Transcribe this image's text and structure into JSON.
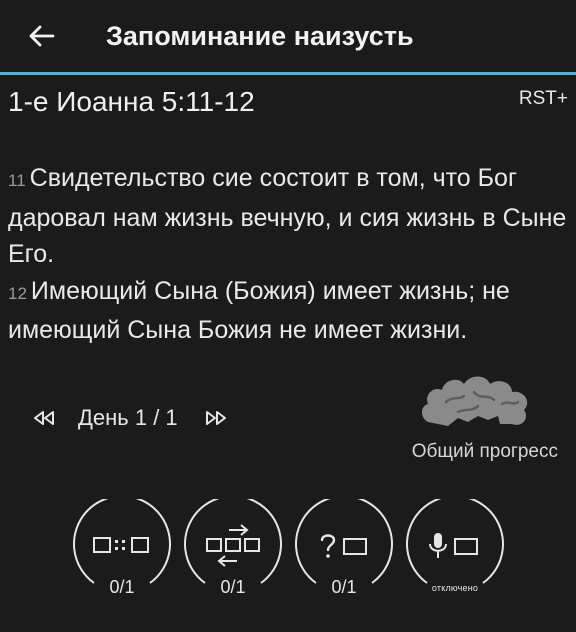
{
  "appbar": {
    "title": "Запоминание наизусть",
    "back_icon": "arrow-left-icon"
  },
  "passage": {
    "reference": "1-е Иоанна 5:11-12",
    "version": "RST+",
    "verses": [
      {
        "number": "11",
        "text": "Свидетельство сие состоит в том, что Бог даровал нам жизнь вечную, и сия жизнь в Сыне Его."
      },
      {
        "number": "12",
        "text": "Имеющий Сына (Божия) имеет жизнь; не имеющий Сына Божия не имеет жизни."
      }
    ]
  },
  "day_nav": {
    "prev_icon": "rewind-icon",
    "label": "День 1 / 1",
    "next_icon": "fast-forward-icon"
  },
  "progress": {
    "icon": "brain-icon",
    "label": "Общий прогресс"
  },
  "modes": [
    {
      "icon": "word-blanks-icon",
      "count": "0/1"
    },
    {
      "icon": "shuffle-words-icon",
      "count": "0/1"
    },
    {
      "icon": "quiz-icon",
      "count": "0/1"
    },
    {
      "icon": "microphone-icon",
      "count": "отключено"
    }
  ],
  "colors": {
    "background": "#1c1b1c",
    "accent_line": "#4fb3d9",
    "text": "#e9e9e9",
    "brain": "#8a8a8a"
  }
}
